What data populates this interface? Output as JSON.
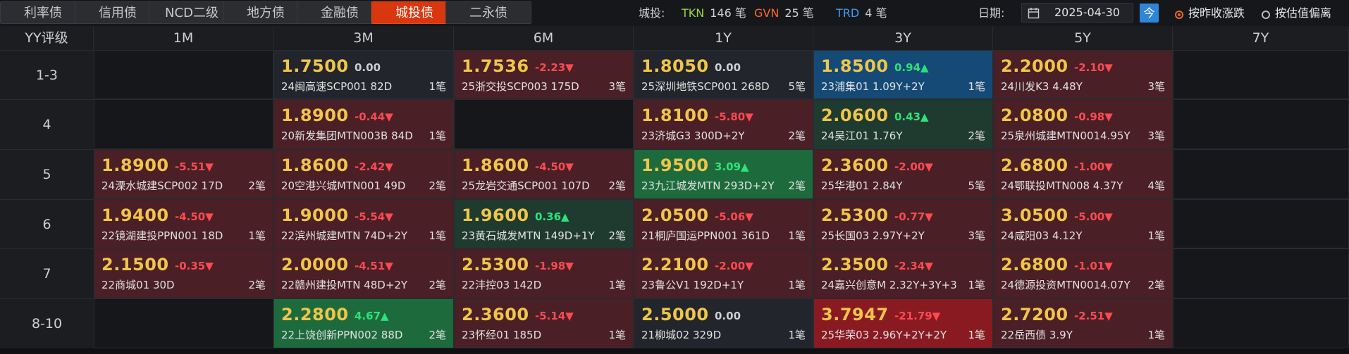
{
  "tabs": [
    "利率债",
    "信用债",
    "NCD二级",
    "地方债",
    "金融债",
    "城投债",
    "二永债"
  ],
  "active_tab": "城投债",
  "summary": {
    "prefix": "城投:",
    "tkn_label": "TKN",
    "tkn_value": "146 笔",
    "gvn_label": "GVN",
    "gvn_value": "25 笔",
    "trd_label": "TRD",
    "trd_value": "4 笔"
  },
  "date": {
    "label": "日期:",
    "value": "2025-04-30",
    "today_label": "今"
  },
  "radios": [
    {
      "label": "按昨收涨跌",
      "selected": true
    },
    {
      "label": "按估值偏离",
      "selected": false
    }
  ],
  "grid": {
    "corner": "YY评级",
    "columns": [
      "1M",
      "3M",
      "6M",
      "1Y",
      "3Y",
      "5Y",
      "7Y"
    ],
    "rows": [
      {
        "label": "1-3",
        "cells": [
          null,
          {
            "rate": "1.7500",
            "chg": "0.00",
            "name": "24闽高速SCP001 82D",
            "count": "1笔",
            "tone": "flat"
          },
          {
            "rate": "1.7536",
            "chg": "-2.23▼",
            "name": "25浙交投SCP003 175D",
            "count": "3笔",
            "tone": "down"
          },
          {
            "rate": "1.8050",
            "chg": "0.00",
            "name": "25深圳地铁SCP001 268D",
            "count": "5笔",
            "tone": "flat"
          },
          {
            "rate": "1.8500",
            "chg": "0.94▲",
            "name": "23浦集01 1.09Y+2Y",
            "count": "1笔",
            "tone": "blue"
          },
          {
            "rate": "2.2000",
            "chg": "-2.10▼",
            "name": "24川发K3 4.48Y",
            "count": "3笔",
            "tone": "down"
          },
          null
        ]
      },
      {
        "label": "4",
        "cells": [
          null,
          {
            "rate": "1.8900",
            "chg": "-0.44▼",
            "name": "20新发集团MTN003B 84D",
            "count": "1笔",
            "tone": "down"
          },
          null,
          {
            "rate": "1.8100",
            "chg": "-5.80▼",
            "name": "23济城G3 300D+2Y",
            "count": "2笔",
            "tone": "down"
          },
          {
            "rate": "2.0600",
            "chg": "0.43▲",
            "name": "24吴江01 1.76Y",
            "count": "2笔",
            "tone": "upd"
          },
          {
            "rate": "2.0800",
            "chg": "-0.98▼",
            "name": "25泉州城建MTN0014.95Y",
            "count": "3笔",
            "tone": "down"
          },
          null
        ]
      },
      {
        "label": "5",
        "cells": [
          {
            "rate": "1.8900",
            "chg": "-5.51▼",
            "name": "24溧水城建SCP002 17D",
            "count": "2笔",
            "tone": "down"
          },
          {
            "rate": "1.8600",
            "chg": "-2.42▼",
            "name": "20空港兴城MTN001 49D",
            "count": "2笔",
            "tone": "down"
          },
          {
            "rate": "1.8600",
            "chg": "-4.50▼",
            "name": "25龙岩交通SCP001 107D",
            "count": "2笔",
            "tone": "down"
          },
          {
            "rate": "1.9500",
            "chg": "3.09▲",
            "name": "23九江城发MTN 293D+2Y",
            "count": "2笔",
            "tone": "up"
          },
          {
            "rate": "2.3600",
            "chg": "-2.00▼",
            "name": "25华港01 2.84Y",
            "count": "5笔",
            "tone": "down"
          },
          {
            "rate": "2.6800",
            "chg": "-1.00▼",
            "name": "24鄂联投MTN008 4.37Y",
            "count": "4笔",
            "tone": "down"
          },
          null
        ]
      },
      {
        "label": "6",
        "cells": [
          {
            "rate": "1.9400",
            "chg": "-4.50▼",
            "name": "22镜湖建投PPN001 18D",
            "count": "1笔",
            "tone": "down"
          },
          {
            "rate": "1.9000",
            "chg": "-5.54▼",
            "name": "22滨州城建MTN 74D+2Y",
            "count": "1笔",
            "tone": "down"
          },
          {
            "rate": "1.9600",
            "chg": "0.36▲",
            "name": "23黄石城发MTN 149D+1Y",
            "count": "2笔",
            "tone": "upd"
          },
          {
            "rate": "2.0500",
            "chg": "-5.06▼",
            "name": "21桐庐国运PPN001 361D",
            "count": "1笔",
            "tone": "down"
          },
          {
            "rate": "2.5300",
            "chg": "-0.77▼",
            "name": "25长国03 2.97Y+2Y",
            "count": "3笔",
            "tone": "down"
          },
          {
            "rate": "3.0500",
            "chg": "-5.00▼",
            "name": "24咸阳03 4.12Y",
            "count": "1笔",
            "tone": "down"
          },
          null
        ]
      },
      {
        "label": "7",
        "cells": [
          {
            "rate": "2.1500",
            "chg": "-0.35▼",
            "name": "22商城01 30D",
            "count": "2笔",
            "tone": "down"
          },
          {
            "rate": "2.0000",
            "chg": "-4.51▼",
            "name": "22赣州建投MTN 48D+2Y",
            "count": "2笔",
            "tone": "down"
          },
          {
            "rate": "2.5300",
            "chg": "-1.98▼",
            "name": "22沣控03 142D",
            "count": "1笔",
            "tone": "down"
          },
          {
            "rate": "2.2100",
            "chg": "-2.00▼",
            "name": "23鲁公V1 192D+1Y",
            "count": "1笔",
            "tone": "down"
          },
          {
            "rate": "2.3500",
            "chg": "-2.34▼",
            "name": "24嘉兴创意M 2.32Y+3Y+3",
            "count": "1笔",
            "tone": "down"
          },
          {
            "rate": "2.6800",
            "chg": "-1.01▼",
            "name": "24德源投资MTN0014.07Y",
            "count": "2笔",
            "tone": "down"
          },
          null
        ]
      },
      {
        "label": "8-10",
        "cells": [
          null,
          {
            "rate": "2.2800",
            "chg": "4.67▲",
            "name": "22上饶创新PPN002 88D",
            "count": "2笔",
            "tone": "up"
          },
          {
            "rate": "2.3600",
            "chg": "-5.14▼",
            "name": "23怀经01 185D",
            "count": "1笔",
            "tone": "down"
          },
          {
            "rate": "2.5000",
            "chg": "0.00",
            "name": "21柳城02 329D",
            "count": "1笔",
            "tone": "flat"
          },
          {
            "rate": "3.7947",
            "chg": "-21.79▼",
            "name": "25华荣03 2.96Y+2Y+2Y",
            "count": "1笔",
            "tone": "downstrong"
          },
          {
            "rate": "2.7200",
            "chg": "-2.51▼",
            "name": "22岳西债 3.9Y",
            "count": "1笔",
            "tone": "down"
          },
          null
        ]
      }
    ]
  },
  "colors": {
    "tkn": "#9fd23a",
    "gvn": "#ff6a2b",
    "trd": "#3f9df0",
    "tone_flat": "#22252b",
    "tone_down": "#4a1f25",
    "tone_downstrong": "#8a1a22",
    "tone_up": "#1d6b3c",
    "tone_upd": "#1f3a2f",
    "tone_blue": "#154a77"
  }
}
